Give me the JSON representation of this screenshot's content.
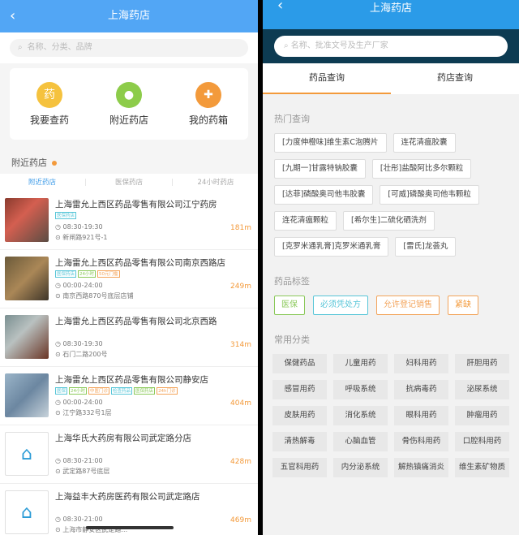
{
  "left": {
    "title": "上海药店",
    "back_icon": "‹",
    "search": {
      "placeholder": "名称、分类、品牌"
    },
    "quick": [
      {
        "label": "我要查药",
        "icon": "medicine-icon",
        "glyph": "药"
      },
      {
        "label": "附近药店",
        "icon": "location-pin-icon",
        "glyph": "●"
      },
      {
        "label": "我的药箱",
        "icon": "medicine-box-icon",
        "glyph": "✚"
      }
    ],
    "section_title": "附近药店",
    "subtabs": [
      "附近药店",
      "医保药店",
      "24小时药店"
    ],
    "pharmacies": [
      {
        "name": "上海雷允上西区药品零售有限公司江宁药房",
        "tags": [
          "医保药店"
        ],
        "hours": "08:30-19:30",
        "address": "新闸路921号-1",
        "distance": "181m"
      },
      {
        "name": "上海雷允上西区药品零售有限公司南京西路店",
        "tags": [
          "医保药店",
          "24小时",
          "50元门槛"
        ],
        "hours": "00:00-24:00",
        "address": "南京西路870号底层店铺",
        "distance": "249m"
      },
      {
        "name": "上海雷允上西区药品零售有限公司北京西路",
        "tags": [],
        "hours": "08:30-19:30",
        "address": "石门二路200号",
        "distance": "314m"
      },
      {
        "name": "上海雷允上西区药品零售有限公司静安店",
        "tags": [
          "医保",
          "24小时",
          "中医门诊",
          "检查药品",
          "医保药店",
          "24h门诊"
        ],
        "hours": "00:00-24:00",
        "address": "江宁路332号1层",
        "distance": "404m"
      },
      {
        "name": "上海华氏大药房有限公司武定路分店",
        "tags": [],
        "hours": "08:30-21:00",
        "address": "武定路87号底层",
        "distance": "428m"
      },
      {
        "name": "上海益丰大药房医药有限公司武定路店",
        "tags": [],
        "hours": "08:30-21:00",
        "address": "上海市静安区武定路…",
        "distance": "469m"
      }
    ]
  },
  "right": {
    "title": "上海药店",
    "back_icon": "‹",
    "search": {
      "placeholder": "名称、批准文号及生产厂家"
    },
    "tabs": [
      "药品查询",
      "药店查询"
    ],
    "hot_title": "热门查询",
    "hot": [
      "[力度伸橙味]维生素C泡腾片",
      "连花清瘟胶囊",
      "[九期一]甘露特钠胶囊",
      "[壮彤]盐酸阿比多尔颗粒",
      "[达菲]磷酸奥司他韦胶囊",
      "[可威]磷酸奥司他韦颗粒",
      "连花清瘟颗粒",
      "[希尔生]二硫化硒洗剂",
      "[克罗米通乳膏]克罗米通乳膏",
      "[雷氏]龙荟丸"
    ],
    "label_title": "药品标签",
    "labels": [
      "医保",
      "必须凭处方",
      "允许登记销售",
      "紧缺"
    ],
    "cat_title": "常用分类",
    "categories": [
      "保健药品",
      "儿童用药",
      "妇科用药",
      "肝胆用药",
      "感冒用药",
      "呼吸系统",
      "抗病毒药",
      "泌尿系统",
      "皮肤用药",
      "消化系统",
      "眼科用药",
      "肿瘤用药",
      "清热解毒",
      "心脑血管",
      "骨伤科用药",
      "口腔科用药",
      "五官科用药",
      "内分泌系统",
      "解热镇痛消炎",
      "维生素矿物质"
    ]
  }
}
